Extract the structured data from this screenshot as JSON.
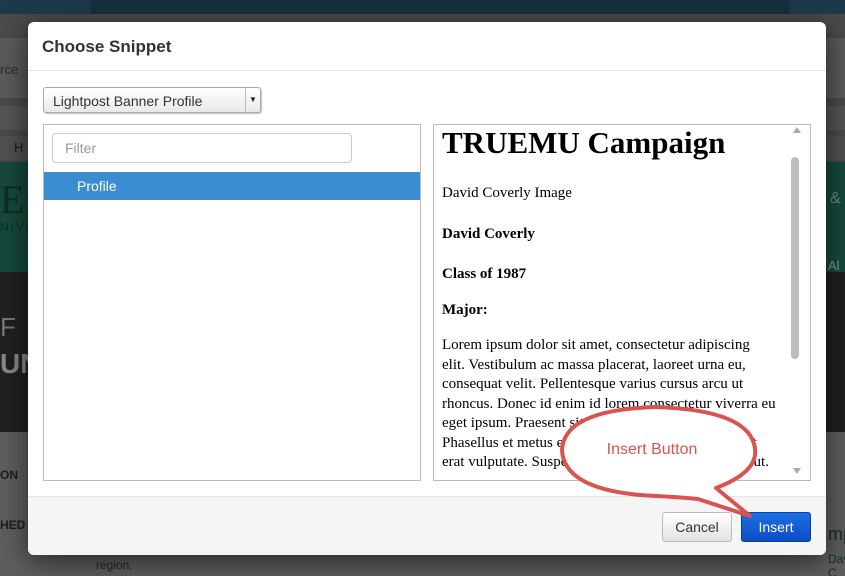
{
  "background": {
    "left_tab_fragment": "rce",
    "toolbar_fragment": "H",
    "banner_letter": "E",
    "banner_sub": "NIVE",
    "banner_amp": "&",
    "banner_al": "Al",
    "photo_f": "F",
    "photo_un": "UN",
    "lower_on": "ON",
    "lower_hed": "HED",
    "lower_region": "region.",
    "lower_mp": "mp",
    "lower_david": "David C"
  },
  "modal": {
    "title": "Choose Snippet",
    "snippet_select": {
      "selected": "Lightpost Banner Profile"
    },
    "filter": {
      "placeholder": "Filter",
      "value": ""
    },
    "list_items": [
      {
        "label": "Profile",
        "selected": true
      }
    ],
    "preview": {
      "heading": "TRUEMU Campaign",
      "image_alt": "David Coverly Image",
      "name": "David Coverly",
      "class_year": "Class of 1987",
      "major_label": "Major:",
      "body": "Lorem ipsum dolor sit amet, consectetur adipiscing elit. Vestibulum ac massa placerat, laoreet urna eu, consequat velit. Pellentesque varius cursus arcu ut rhoncus. Donec id enim id lorem consectetur viverra eu eget ipsum. Praesent sit amet tellus non tristique. Phasellus et metus eget sem sodales. Ut eget enim et erat vulputate. Suspendisse arcu neque, consectetur ut."
    },
    "footer": {
      "cancel_label": "Cancel",
      "insert_label": "Insert"
    }
  },
  "annotation": {
    "text": "Insert Button",
    "stroke_color": "#d9534f",
    "text_color": "#d9534f"
  },
  "colors": {
    "selected_item_bg": "#3a8dd0",
    "insert_button_bg": "#0c4cc4"
  }
}
